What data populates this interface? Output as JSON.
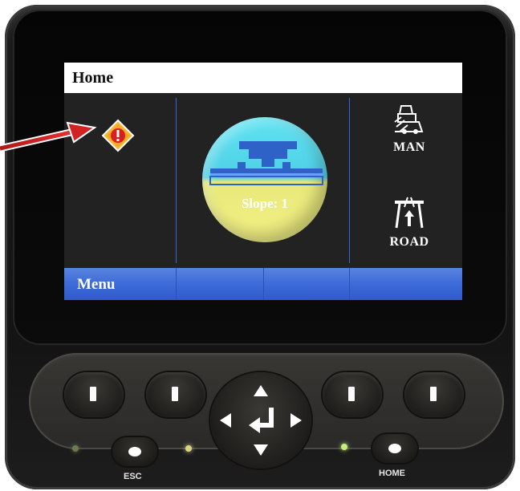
{
  "screen": {
    "title": "Home",
    "slope": {
      "label": "Slope:  1"
    },
    "modes": [
      {
        "label": "MAN",
        "icon": "paver-icon"
      },
      {
        "label": "ROAD",
        "icon": "road-icon"
      }
    ],
    "menu": {
      "label": "Menu"
    },
    "warning_icon": "warning-diamond-icon"
  },
  "keypad": {
    "esc_label": "ESC",
    "home_label": "HOME",
    "led_colors": [
      "#6b7a52",
      "#d9d38a",
      "#c6ef7a"
    ]
  },
  "colors": {
    "accent": "#3d6bd8",
    "warning": "#f7b733",
    "arrow": "#c81a1a"
  }
}
